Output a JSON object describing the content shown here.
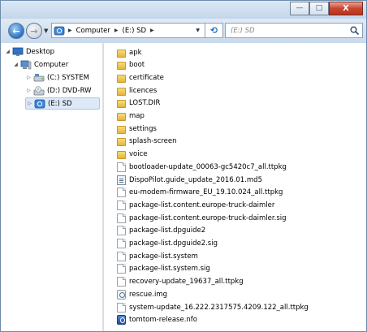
{
  "window": {
    "minimize_glyph": "—",
    "maximize_glyph": "□",
    "close_glyph": "X"
  },
  "navigation": {
    "back_glyph": "←",
    "forward_glyph": "→",
    "breadcrumb": [
      "Computer",
      "(E:) SD"
    ],
    "search_placeholder": "(E:) SD"
  },
  "tree": {
    "items": [
      {
        "label": "Desktop",
        "icon": "desktop-icon"
      },
      {
        "label": "Computer",
        "icon": "computer-icon"
      },
      {
        "label": "(C:) SYSTEM",
        "icon": "hard-drive-icon"
      },
      {
        "label": "(D:) DVD-RW",
        "icon": "dvd-drive-icon"
      },
      {
        "label": "(E:) SD",
        "icon": "sd-card-icon",
        "selected": true
      }
    ]
  },
  "files": [
    {
      "name": "apk",
      "type": "folder"
    },
    {
      "name": "boot",
      "type": "folder"
    },
    {
      "name": "certificate",
      "type": "folder"
    },
    {
      "name": "licences",
      "type": "folder"
    },
    {
      "name": "LOST.DIR",
      "type": "folder"
    },
    {
      "name": "map",
      "type": "folder"
    },
    {
      "name": "settings",
      "type": "folder"
    },
    {
      "name": "splash-screen",
      "type": "folder"
    },
    {
      "name": "voice",
      "type": "folder"
    },
    {
      "name": "bootloader-update_00063-gc5420c7_all.ttpkg",
      "type": "file"
    },
    {
      "name": "DispoPilot.guide_update_2016.01.md5",
      "type": "md5"
    },
    {
      "name": "eu-modem-firmware_EU_19.10.024_all.ttpkg",
      "type": "file"
    },
    {
      "name": "package-list.content.europe-truck-daimler",
      "type": "file"
    },
    {
      "name": "package-list.content.europe-truck-daimler.sig",
      "type": "file"
    },
    {
      "name": "package-list.dpguide2",
      "type": "file"
    },
    {
      "name": "package-list.dpguide2.sig",
      "type": "file"
    },
    {
      "name": "package-list.system",
      "type": "file"
    },
    {
      "name": "package-list.system.sig",
      "type": "file"
    },
    {
      "name": "recovery-update_19637_all.ttpkg",
      "type": "file"
    },
    {
      "name": "rescue.img",
      "type": "img"
    },
    {
      "name": "system-update_16.222.2317575.4209.122_all.ttpkg",
      "type": "file"
    },
    {
      "name": "tomtom-release.nfo",
      "type": "nfo"
    }
  ]
}
